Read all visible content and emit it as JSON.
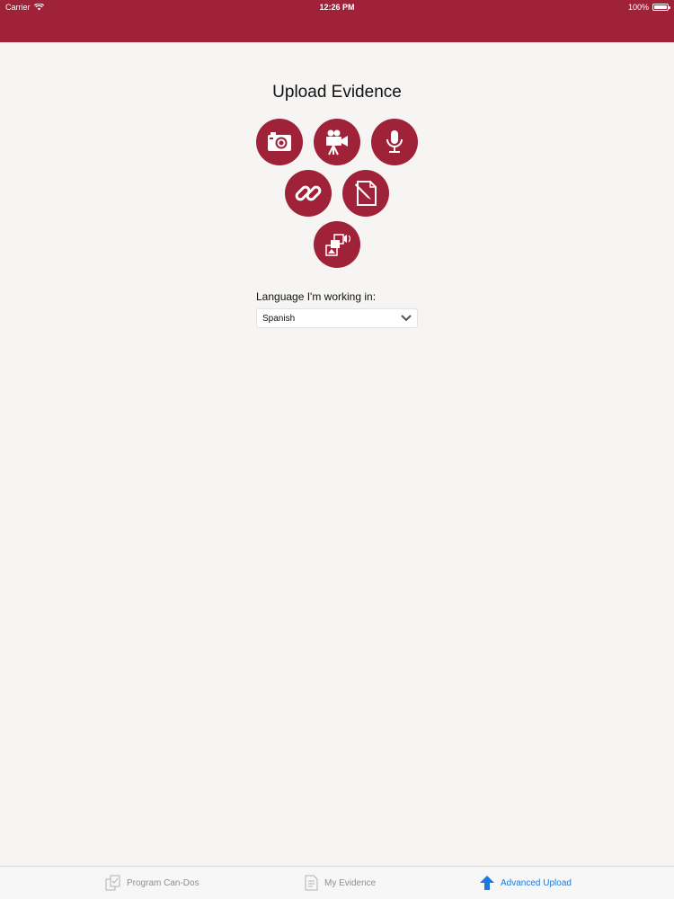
{
  "status_bar": {
    "carrier": "Carrier",
    "time": "12:26 PM",
    "battery": "100%"
  },
  "page": {
    "title": "Upload Evidence"
  },
  "upload_options": [
    {
      "icon": "camera-icon"
    },
    {
      "icon": "video-camera-icon"
    },
    {
      "icon": "microphone-icon"
    },
    {
      "icon": "link-icon"
    },
    {
      "icon": "document-edit-icon"
    },
    {
      "icon": "media-gallery-icon"
    }
  ],
  "language": {
    "label": "Language I'm working in:",
    "selected": "Spanish"
  },
  "tabbar": {
    "tabs": [
      {
        "label": "Program Can-Dos",
        "icon": "program-can-dos-icon"
      },
      {
        "label": "My Evidence",
        "icon": "my-evidence-icon"
      },
      {
        "label": "Advanced Upload",
        "icon": "upload-arrow-icon",
        "active": true
      }
    ]
  },
  "colors": {
    "accent": "#a02238",
    "active_tab": "#1a7ae0",
    "inactive_tab": "#8e8e93"
  }
}
